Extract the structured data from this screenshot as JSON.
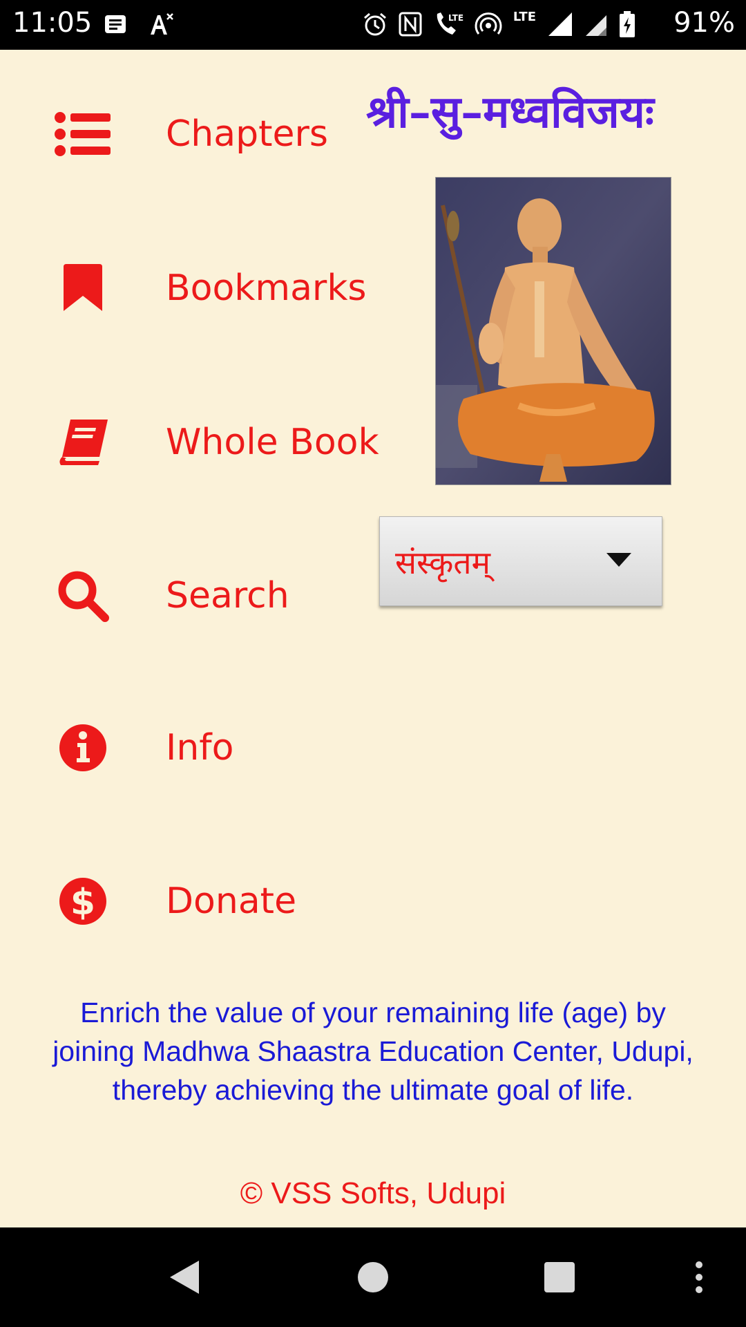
{
  "status_bar": {
    "time": "11:05",
    "battery_percent": "91%",
    "network_label": "LTE",
    "icons_left": [
      "message-icon",
      "text-size-icon"
    ],
    "icons_right": [
      "alarm-icon",
      "nfc-icon",
      "volte-call-icon",
      "hotspot-icon",
      "signal-icon",
      "signal-icon-2",
      "battery-charging-icon"
    ]
  },
  "app": {
    "title": "श्री–सु–मध्वविजयः",
    "menu": [
      {
        "label": "Chapters",
        "icon": "list-icon"
      },
      {
        "label": "Bookmarks",
        "icon": "bookmark-icon"
      },
      {
        "label": "Whole Book",
        "icon": "book-icon"
      },
      {
        "label": "Search",
        "icon": "search-icon"
      },
      {
        "label": "Info",
        "icon": "info-icon"
      },
      {
        "label": "Donate",
        "icon": "dollar-icon"
      }
    ],
    "language_select": {
      "value": "संस्कृतम्"
    },
    "promo_text": "Enrich the value of your remaining life (age) by\njoining  Madhwa Shaastra Education Center, Udupi,\nthereby achieving the ultimate goal of life.",
    "copyright": "© VSS Softs, Udupi",
    "colors": {
      "accent": "#ec1a1a",
      "title": "#5a1fe0",
      "promo": "#1a1ad6",
      "background": "#fbf2d9"
    }
  },
  "nav_bar": {
    "buttons": [
      "back-button",
      "home-button",
      "recents-button",
      "menu-button"
    ]
  }
}
